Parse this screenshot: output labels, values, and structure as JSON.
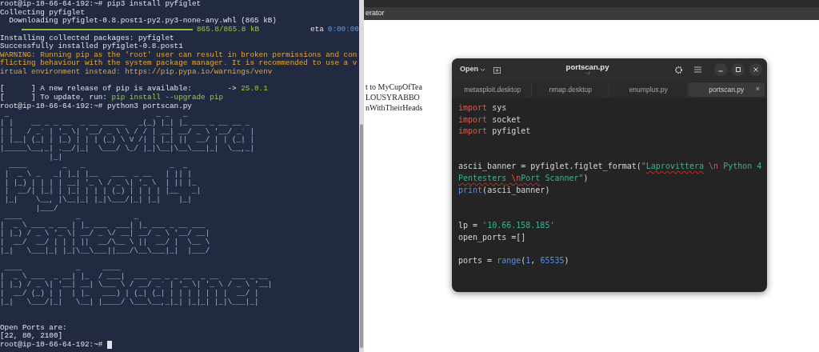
{
  "terminal": {
    "lines": [
      {
        "kind": "text",
        "segments": [
          {
            "text": "root@ip-10-66-64-192:~# pip3 install pyfiglet",
            "kind": "plain"
          }
        ]
      },
      {
        "kind": "text",
        "segments": [
          {
            "text": "Collecting pyfiglet",
            "kind": "plain"
          }
        ]
      },
      {
        "kind": "text",
        "segments": [
          {
            "text": "  Downloading pyfiglet-0.8.post1-py2.py3-none-any.whl (865 kB)",
            "kind": "plain"
          }
        ]
      },
      {
        "kind": "progress",
        "level": 1,
        "segments": [
          {
            "text": "865.8/865.8 kB",
            "kind": "green"
          },
          {
            "text": "eta",
            "kind": "plain"
          },
          {
            "text": "0:00:00",
            "kind": "blue"
          }
        ]
      },
      {
        "kind": "text",
        "segments": [
          {
            "text": "Installing collected packages: pyfiglet",
            "kind": "plain"
          }
        ]
      },
      {
        "kind": "text",
        "segments": [
          {
            "text": "Successfully installed pyfiglet-0.8.post1",
            "kind": "plain"
          }
        ]
      },
      {
        "kind": "text",
        "segments": [
          {
            "text": "WARNING: Running pip as the 'root' user can result in broken permissions and con",
            "kind": "warn"
          }
        ]
      },
      {
        "kind": "text",
        "segments": [
          {
            "text": "flicting behaviour with the system package manager. It is recommended to use a v",
            "kind": "warn"
          }
        ]
      },
      {
        "kind": "text",
        "segments": [
          {
            "text": "irtual environment instead: https://pip.pypa.io/warnings/venv",
            "kind": "warn"
          }
        ]
      },
      {
        "kind": "blank"
      },
      {
        "kind": "text",
        "segments": [
          {
            "text": "[      ] A new release of pip is available:        -> ",
            "kind": "plain"
          },
          {
            "text": "25.0.1",
            "kind": "green"
          }
        ]
      },
      {
        "kind": "text",
        "segments": [
          {
            "text": "[      ] To update, run: ",
            "kind": "plain"
          },
          {
            "text": "pip install --upgrade pip",
            "kind": "green"
          }
        ]
      },
      {
        "kind": "text",
        "segments": [
          {
            "text": "root@ip-10-66-64-192:~# python3 portscan.py",
            "kind": "plain"
          }
        ]
      },
      {
        "kind": "banner",
        "blocks": [
          [
            " _                                 _ _   _",
            "| |    __ _ _ __  _ __ _____   _(_) |_| |_ ___ _ __ __ _",
            "| |   / _` | '_ \\| '__/ _ \\ \\ / / | __| __/ _ \\ '__/ _` |",
            "| |__| (_| | |_) | | | (_) \\ V /| | |_| ||  __/ | | (_| |",
            "|_____\\__,_| .__/|_|  \\___/ \\_/ |_|\\__|\\__\\___|_|  \\__,_|",
            "           |_|"
          ],
          [
            "  ____        _   _                   _  _",
            " |  _ \\ _   _| |_| |__   ___  _ __   | || |",
            " | |_) | | | | __| '_ \\ / _ \\| '_ \\  | || |_",
            " |  __/| |_| | |_| | | | (_) | | | | |__   _|",
            " |_|    \\__, |\\__|_| |_|\\___/|_| |_|    |_|",
            "        |___/"
          ],
          [
            " ____            _            _",
            "|  _ \\ ___ _ __ | |_ ___  ___| |_ ___ _ __ ___",
            "| |_) / _ \\ '_ \\| __/ _ \\/ __| __/ _ \\ '__/ __|",
            "|  __/  __/ | | | ||  __/\\__ \\ ||  __/ |  \\__ \\",
            "|_|   \\___|_| |_|\\__\\___||___/\\__\\___|_|  |___/"
          ],
          [
            " ____            _     ____",
            "|  _ \\ ___  _ __| |_  / ___|  ___ __ _ _ __  _ __   ___ _ __",
            "| |_) / _ \\| '__| __| \\___ \\ / __/ _` | '_ \\| '_ \\ / _ \\ '__|",
            "|  __/ (_) | |  | |_   ___) | (_| (_| | | | | | | |  __/ |",
            "|_|   \\___/|_|   \\__| |____/ \\___\\__,_|_| |_|_| |_|\\___|_|"
          ]
        ]
      },
      {
        "kind": "blank"
      },
      {
        "kind": "text",
        "segments": [
          {
            "text": "Open Ports are:",
            "kind": "plain"
          }
        ]
      },
      {
        "kind": "text",
        "segments": [
          {
            "text": "[22, 80, 2100]",
            "kind": "plain"
          }
        ]
      },
      {
        "kind": "prompt",
        "segments": [
          {
            "text": "root@ip-10-66-64-192:~# ",
            "kind": "plain"
          }
        ]
      }
    ]
  },
  "browser": {
    "bookmark": "erator",
    "page_lines": [
      "t to MyCupOfTea",
      "LOUSYRABBO",
      "nWithTheirHeads"
    ]
  },
  "editor": {
    "open_label": "Open",
    "title": "portscan.py",
    "subtitle": "~/",
    "tabs": [
      {
        "label": "metasploit.desktop",
        "selected": false
      },
      {
        "label": "nmap.desktop",
        "selected": false
      },
      {
        "label": "enumplus.py",
        "selected": false
      },
      {
        "label": "portscan.py",
        "selected": true,
        "close": "×"
      }
    ],
    "lines": [
      {
        "kind": "code",
        "tokens": [
          {
            "text": "import",
            "kind": "keyword"
          },
          {
            "text": " sys",
            "kind": "plain"
          }
        ]
      },
      {
        "kind": "code",
        "tokens": [
          {
            "text": "import",
            "kind": "keyword"
          },
          {
            "text": " socket",
            "kind": "plain"
          }
        ]
      },
      {
        "kind": "code",
        "tokens": [
          {
            "text": "import",
            "kind": "keyword"
          },
          {
            "text": " pyfiglet",
            "kind": "plain"
          }
        ]
      },
      {
        "kind": "blank"
      },
      {
        "kind": "blank"
      },
      {
        "kind": "code",
        "tokens": [
          {
            "text": "ascii_banner = pyfiglet.figlet_format(",
            "kind": "plain"
          },
          {
            "text": "\"",
            "kind": "string"
          },
          {
            "text": "Laprovittera",
            "kind": "string",
            "misspelled": true
          },
          {
            "text": " \\n",
            "kind": "escape"
          },
          {
            "text": " Python 4",
            "kind": "string"
          }
        ]
      },
      {
        "kind": "code",
        "tokens": [
          {
            "text": "Pentesters",
            "kind": "string",
            "misspelled": true
          },
          {
            "text": " \\n",
            "kind": "escape",
            "misspelled": true
          },
          {
            "text": "Port",
            "kind": "string",
            "misspelled": true
          },
          {
            "text": " Scanner\"",
            "kind": "string"
          },
          {
            "text": ")",
            "kind": "plain"
          }
        ]
      },
      {
        "kind": "code",
        "tokens": [
          {
            "text": "print",
            "kind": "builtin"
          },
          {
            "text": "(ascii_banner)",
            "kind": "plain"
          }
        ]
      },
      {
        "kind": "blank"
      },
      {
        "kind": "blank"
      },
      {
        "kind": "code",
        "tokens": [
          {
            "text": "lp = ",
            "kind": "plain"
          },
          {
            "text": "'10.66.158.185'",
            "kind": "string"
          }
        ]
      },
      {
        "kind": "code",
        "tokens": [
          {
            "text": "open_ports =[]",
            "kind": "plain"
          }
        ]
      },
      {
        "kind": "blank"
      },
      {
        "kind": "code",
        "tokens": [
          {
            "text": "ports = ",
            "kind": "plain"
          },
          {
            "text": "range",
            "kind": "builtin"
          },
          {
            "text": "(",
            "kind": "plain"
          },
          {
            "text": "1",
            "kind": "number"
          },
          {
            "text": ", ",
            "kind": "plain"
          },
          {
            "text": "65535",
            "kind": "number"
          },
          {
            "text": ")",
            "kind": "plain"
          }
        ]
      }
    ]
  }
}
